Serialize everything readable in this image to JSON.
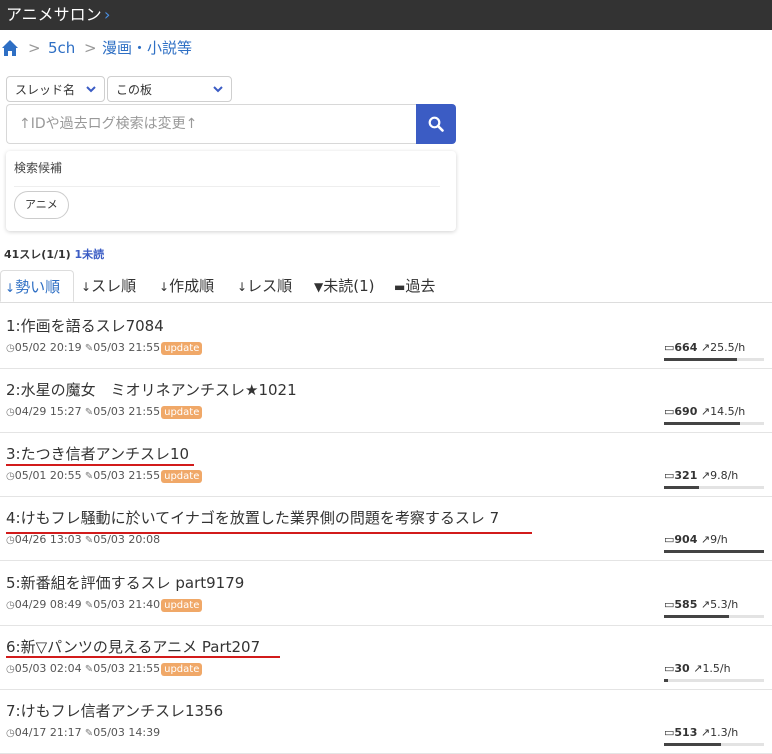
{
  "app": {
    "title": "アニメサロン",
    "chevron": "›"
  },
  "breadcrumb": {
    "sep": ">",
    "items": [
      "5ch",
      "漫画・小説等"
    ]
  },
  "search": {
    "scope1": "スレッド名",
    "scope2": "この板",
    "placeholder": "↑IDや過去ログ検索は変更↑"
  },
  "suggest": {
    "heading": "検索候補",
    "chips": [
      "アニメ"
    ]
  },
  "list_count": {
    "text": "41スレ(1/1)",
    "unread": "1未読"
  },
  "tabs": [
    {
      "icon": "↓",
      "label": "勢い順"
    },
    {
      "icon": "↓",
      "label": "スレ順"
    },
    {
      "icon": "↓",
      "label": "作成順"
    },
    {
      "icon": "↓",
      "label": "レス順"
    },
    {
      "icon": "▼",
      "label": "未読(1)"
    },
    {
      "icon": "▬",
      "label": "過去"
    }
  ],
  "threads": [
    {
      "title": "1:作画を語るスレ7084",
      "created": "05/02 20:19",
      "updated": "05/03 21:55",
      "badge": "update",
      "res": "664",
      "speed": "25.5/h",
      "bar": 0.73
    },
    {
      "title": "2:水星の魔女　ミオリネアンチスレ★1021",
      "created": "04/29 15:27",
      "updated": "05/03 21:55",
      "badge": "update",
      "res": "690",
      "speed": "14.5/h",
      "bar": 0.76
    },
    {
      "title": "3:たつき信者アンチスレ10",
      "created": "05/01 20:55",
      "updated": "05/03 21:55",
      "badge": "update",
      "res": "321",
      "speed": "9.8/h",
      "bar": 0.35
    },
    {
      "title": "4:けもフレ騒動に於いてイナゴを放置した業界側の問題を考察するスレ 7",
      "created": "04/26 13:03",
      "updated": "05/03 20:08",
      "badge": "",
      "res": "904",
      "speed": "9/h",
      "bar": 1.0
    },
    {
      "title": "5:新番組を評価するスレ part9179",
      "created": "04/29 08:49",
      "updated": "05/03 21:40",
      "badge": "update",
      "res": "585",
      "speed": "5.3/h",
      "bar": 0.65
    },
    {
      "title": "6:新▽パンツの見えるアニメ Part207",
      "created": "05/03 02:04",
      "updated": "05/03 21:55",
      "badge": "update",
      "res": "30",
      "speed": "1.5/h",
      "bar": 0.04
    },
    {
      "title": "7:けもフレ信者アンチスレ1356",
      "created": "04/17 21:17",
      "updated": "05/03 14:39",
      "badge": "",
      "res": "513",
      "speed": "1.3/h",
      "bar": 0.57
    }
  ],
  "colors": {
    "appbar": "#333333",
    "link": "#2e6fc4",
    "accent": "#3b5cc4",
    "badge": "#f0a868",
    "underline": "#d21b1b"
  }
}
